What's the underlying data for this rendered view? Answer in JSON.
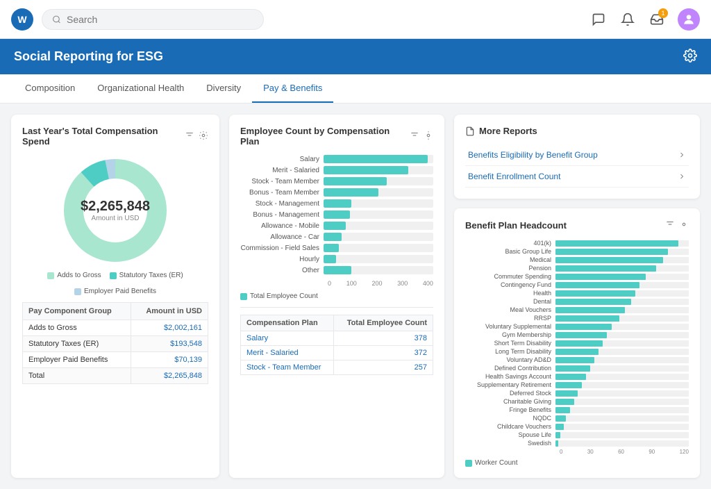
{
  "nav": {
    "logo": "W",
    "search_placeholder": "Search",
    "badge_count": "1",
    "icons": [
      "chat-icon",
      "bell-icon",
      "inbox-icon",
      "avatar-icon"
    ]
  },
  "header": {
    "title": "Social Reporting for ESG",
    "gear_label": "Settings"
  },
  "tabs": [
    {
      "id": "composition",
      "label": "Composition",
      "active": false
    },
    {
      "id": "org-health",
      "label": "Organizational Health",
      "active": false
    },
    {
      "id": "diversity",
      "label": "Diversity",
      "active": false
    },
    {
      "id": "pay-benefits",
      "label": "Pay & Benefits",
      "active": true
    }
  ],
  "compensation_card": {
    "title": "Last Year's Total Compensation Spend",
    "amount": "$2,265,848",
    "amount_label": "Amount in USD",
    "legend": [
      {
        "label": "Adds to Gross",
        "color": "#a8e6cf"
      },
      {
        "label": "Statutory Taxes (ER)",
        "color": "#4ecdc4"
      },
      {
        "label": "Employer Paid Benefits",
        "color": "#b3d4e8"
      }
    ],
    "table_headers": [
      "Pay Component Group",
      "Amount in USD"
    ],
    "table_rows": [
      {
        "group": "Adds to Gross",
        "amount": "$2,002,161"
      },
      {
        "group": "Statutory Taxes (ER)",
        "amount": "$193,548"
      },
      {
        "group": "Employer Paid Benefits",
        "amount": "$70,139"
      },
      {
        "group": "Total",
        "amount": "$2,265,848"
      }
    ]
  },
  "employee_count_card": {
    "title": "Employee Count by Compensation Plan",
    "bars": [
      {
        "label": "Salary",
        "value": 380,
        "max": 400
      },
      {
        "label": "Merit - Salaried",
        "value": 310,
        "max": 400
      },
      {
        "label": "Stock - Team Member",
        "value": 230,
        "max": 400
      },
      {
        "label": "Bonus - Team Member",
        "value": 200,
        "max": 400
      },
      {
        "label": "Stock - Management",
        "value": 100,
        "max": 400
      },
      {
        "label": "Bonus - Management",
        "value": 95,
        "max": 400
      },
      {
        "label": "Allowance - Mobile",
        "value": 80,
        "max": 400
      },
      {
        "label": "Allowance - Car",
        "value": 65,
        "max": 400
      },
      {
        "label": "Commission - Field Sales",
        "value": 55,
        "max": 400
      },
      {
        "label": "Hourly",
        "value": 45,
        "max": 400
      },
      {
        "label": "Other",
        "value": 100,
        "max": 400
      }
    ],
    "axis_labels": [
      "0",
      "100",
      "200",
      "300",
      "400"
    ],
    "legend_label": "Total Employee Count",
    "table_headers": [
      "Compensation Plan",
      "Total Employee Count"
    ],
    "table_rows": [
      {
        "plan": "Salary",
        "count": "378"
      },
      {
        "plan": "Merit - Salaried",
        "count": "372"
      },
      {
        "plan": "Stock - Team Member",
        "count": "257"
      }
    ]
  },
  "more_reports_card": {
    "title": "More Reports",
    "reports": [
      {
        "label": "Benefits Eligibility by Benefit Group"
      },
      {
        "label": "Benefit Enrollment Count"
      }
    ]
  },
  "benefit_headcount_card": {
    "title": "Benefit Plan Headcount",
    "bars": [
      {
        "label": "401(k)",
        "value": 120,
        "max": 130
      },
      {
        "label": "Basic Group Life",
        "value": 110,
        "max": 130
      },
      {
        "label": "Medical",
        "value": 105,
        "max": 130
      },
      {
        "label": "Pension",
        "value": 98,
        "max": 130
      },
      {
        "label": "Commuter Spending",
        "value": 88,
        "max": 130
      },
      {
        "label": "Contingency Fund",
        "value": 82,
        "max": 130
      },
      {
        "label": "Health",
        "value": 78,
        "max": 130
      },
      {
        "label": "Dental",
        "value": 74,
        "max": 130
      },
      {
        "label": "Meal Vouchers",
        "value": 68,
        "max": 130
      },
      {
        "label": "RRSP",
        "value": 62,
        "max": 130
      },
      {
        "label": "Voluntary Supplemental",
        "value": 55,
        "max": 130
      },
      {
        "label": "Gym Membership",
        "value": 50,
        "max": 130
      },
      {
        "label": "Short Term Disability",
        "value": 46,
        "max": 130
      },
      {
        "label": "Long Term Disability",
        "value": 42,
        "max": 130
      },
      {
        "label": "Voluntary AD&D",
        "value": 38,
        "max": 130
      },
      {
        "label": "Defined Contribution",
        "value": 34,
        "max": 130
      },
      {
        "label": "Health Savings Account",
        "value": 30,
        "max": 130
      },
      {
        "label": "Supplementary Retirement",
        "value": 26,
        "max": 130
      },
      {
        "label": "Deferred Stock",
        "value": 22,
        "max": 130
      },
      {
        "label": "Charitable Giving",
        "value": 18,
        "max": 130
      },
      {
        "label": "Fringe Benefits",
        "value": 14,
        "max": 130
      },
      {
        "label": "NQDC",
        "value": 10,
        "max": 130
      },
      {
        "label": "Childcare Vouchers",
        "value": 8,
        "max": 130
      },
      {
        "label": "Spouse Life",
        "value": 5,
        "max": 130
      },
      {
        "label": "Swedish",
        "value": 3,
        "max": 130
      }
    ],
    "axis_labels": [
      "0",
      "30",
      "60",
      "90",
      "120"
    ],
    "legend_label": "Worker Count"
  }
}
